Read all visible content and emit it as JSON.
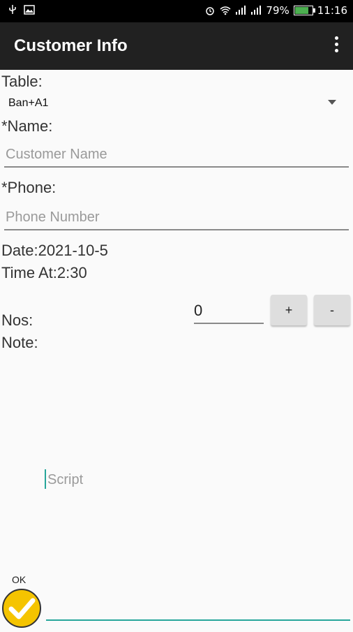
{
  "status_bar": {
    "time": "11:16",
    "battery_percent": "79%"
  },
  "app_bar": {
    "title": "Customer Info"
  },
  "form": {
    "table_label": "Table:",
    "table_value": "Ban+A1",
    "name_label": "*Name:",
    "name_placeholder": "Customer Name",
    "phone_label": "*Phone:",
    "phone_placeholder": "Phone Number",
    "date_text": "Date:2021-10-5",
    "time_text": "Time At:2:30",
    "nos_label": "Nos:",
    "nos_value": "0",
    "plus_label": "+",
    "minus_label": "-",
    "note_label": "Note:",
    "script_placeholder": "Script"
  },
  "ok": {
    "label": "OK"
  },
  "colors": {
    "accent": "#26a69a",
    "appbar": "#212121",
    "ok_icon": "#f5c400"
  }
}
